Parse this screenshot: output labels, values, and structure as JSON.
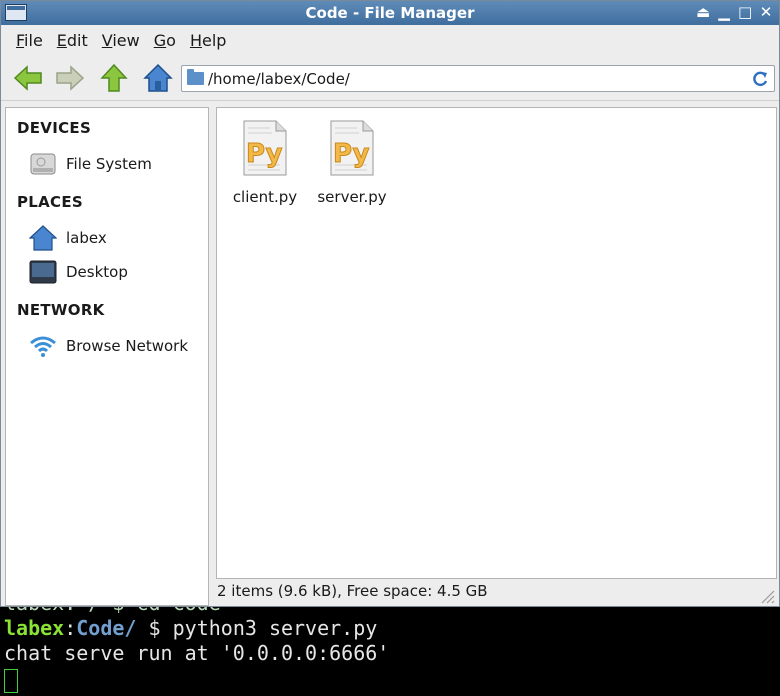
{
  "window": {
    "title": "Code - File Manager",
    "controls": [
      "⏏",
      "▁",
      "□",
      "✕"
    ]
  },
  "menu": {
    "items": [
      {
        "key": "F",
        "rest": "ile"
      },
      {
        "key": "E",
        "rest": "dit"
      },
      {
        "key": "V",
        "rest": "iew"
      },
      {
        "key": "G",
        "rest": "o"
      },
      {
        "key": "H",
        "rest": "elp"
      }
    ]
  },
  "toolbar": {
    "address": "/home/labex/Code/"
  },
  "sidebar": {
    "devices_heading": "DEVICES",
    "places_heading": "PLACES",
    "network_heading": "NETWORK",
    "file_system": "File System",
    "home": "labex",
    "desktop": "Desktop",
    "browse_network": "Browse Network"
  },
  "files": [
    {
      "name": "client.py",
      "icon": "python-file-icon"
    },
    {
      "name": "server.py",
      "icon": "python-file-icon"
    }
  ],
  "status": "2 items (9.6 kB), Free space: 4.5 GB",
  "terminal": {
    "partial_line": "labex:~/ $ cd Code",
    "prompt_user": "labex",
    "prompt_sep": ":",
    "prompt_path": "Code/",
    "prompt_symbol": " $ ",
    "command": "python3 server.py",
    "output": "chat serve run at '0.0.0.0:6666'"
  },
  "colors": {
    "titlebar": "#4a79a8",
    "arrow_green": "#7cc33a",
    "home_blue": "#3e7cc4",
    "term_user": "#8ae234",
    "term_path": "#729fcf"
  }
}
